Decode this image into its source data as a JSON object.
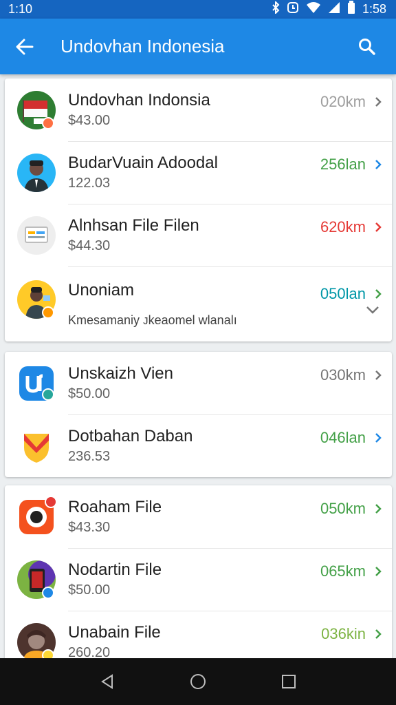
{
  "status_bar": {
    "time": "1:10",
    "right_time": "1:58",
    "icons": [
      "bluetooth-icon",
      "alarm-icon",
      "wifi-icon",
      "signal-icon",
      "battery-icon"
    ]
  },
  "app_bar": {
    "title": "Undovhan Indonesia",
    "back_icon": "arrow-left-icon",
    "search_icon": "search-icon",
    "color": "#1e88e5"
  },
  "groups": [
    {
      "items": [
        {
          "name": "Undovhan Indonsia",
          "sub": "$43.00",
          "dist": "020km",
          "dist_color": "#9e9e9e",
          "chev_color": "#757575"
        },
        {
          "name": "BudarVuain Adoodal",
          "sub": "122.03",
          "dist": "256lan",
          "dist_color": "#43a047",
          "chev_color": "#1e88e5"
        },
        {
          "name": "Alnhsan File Filen",
          "sub": "$44.30",
          "dist": "620km",
          "dist_color": "#e53935",
          "chev_color": "#e53935"
        },
        {
          "name": "Unoniam",
          "sub": "Kmesamaniy ᴊkeaomel wlanalı",
          "dist": "050lan",
          "dist_color": "#0097a7",
          "chev_color": "#43a047"
        }
      ]
    },
    {
      "items": [
        {
          "name": "Unskaizh Vien",
          "sub": "$50.00",
          "dist": "030km",
          "dist_color": "#757575",
          "chev_color": "#757575"
        },
        {
          "name": "Dotbahan Daban",
          "sub": "236.53",
          "dist": "046lan",
          "dist_color": "#43a047",
          "chev_color": "#1e88e5"
        }
      ]
    },
    {
      "items": [
        {
          "name": "Roaham File",
          "sub": "$43.30",
          "dist": "050km",
          "dist_color": "#43a047",
          "chev_color": "#43a047"
        },
        {
          "name": "Nodartin File",
          "sub": "$50.00",
          "dist": "065km",
          "dist_color": "#43a047",
          "chev_color": "#43a047"
        },
        {
          "name": "Unabain File",
          "sub": "260.20",
          "dist": "036kin",
          "dist_color": "#7cb342",
          "chev_color": "#43a047"
        }
      ]
    }
  ],
  "nav_bar": {
    "icons": [
      "back-triangle-icon",
      "home-circle-icon",
      "recents-square-icon"
    ]
  }
}
